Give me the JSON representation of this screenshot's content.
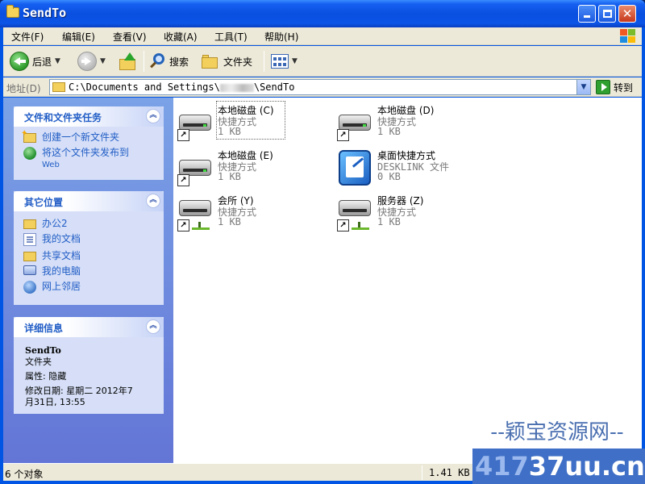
{
  "window": {
    "title": "SendTo"
  },
  "menu": [
    "文件(F)",
    "编辑(E)",
    "查看(V)",
    "收藏(A)",
    "工具(T)",
    "帮助(H)"
  ],
  "toolbar": {
    "back_label": "后退",
    "search_label": "搜索",
    "folders_label": "文件夹"
  },
  "address": {
    "label": "地址(D)",
    "path_prefix": "C:\\Documents and Settings\\",
    "path_suffix": "\\SendTo",
    "go_label": "转到"
  },
  "tasks_panel": {
    "title": "文件和文件夹任务",
    "items": [
      {
        "label": "创建一个新文件夹",
        "icon": "new-folder-icon"
      },
      {
        "label": "将这个文件夹发布到",
        "sublabel": "Web",
        "icon": "web-publish-icon"
      }
    ]
  },
  "places_panel": {
    "title": "其它位置",
    "items": [
      {
        "label": "办公2",
        "icon": "folder-icon"
      },
      {
        "label": "我的文档",
        "icon": "documents-icon"
      },
      {
        "label": "共享文档",
        "icon": "shared-folder-icon"
      },
      {
        "label": "我的电脑",
        "icon": "computer-icon"
      },
      {
        "label": "网上邻居",
        "icon": "network-icon"
      }
    ]
  },
  "details_panel": {
    "title": "详细信息",
    "name": "SendTo",
    "kind": "文件夹",
    "attributes": "属性: 隐藏",
    "modified_line1": "修改日期: 星期二 2012年7",
    "modified_line2": "月31日, 13:55"
  },
  "files": [
    {
      "name": "本地磁盘 (C)",
      "type": "快捷方式",
      "size": "1 KB",
      "icon": "drive-shortcut-icon"
    },
    {
      "name": "本地磁盘 (D)",
      "type": "快捷方式",
      "size": "1 KB",
      "icon": "drive-shortcut-icon"
    },
    {
      "name": "本地磁盘 (E)",
      "type": "快捷方式",
      "size": "1 KB",
      "icon": "drive-shortcut-icon"
    },
    {
      "name": "桌面快捷方式",
      "type": "DESKLINK 文件",
      "size": "0 KB",
      "icon": "desklink-icon"
    },
    {
      "name": "会所 (Y)",
      "type": "快捷方式",
      "size": "1 KB",
      "icon": "network-drive-shortcut-icon"
    },
    {
      "name": "服务器 (Z)",
      "type": "快捷方式",
      "size": "1 KB",
      "icon": "network-drive-shortcut-icon"
    }
  ],
  "status": {
    "count": "6 个对象",
    "size": "1.41 KB"
  },
  "watermark": {
    "top": "--颖宝资源网--",
    "bottom_dim": "417",
    "bottom": "37uu.cn"
  }
}
